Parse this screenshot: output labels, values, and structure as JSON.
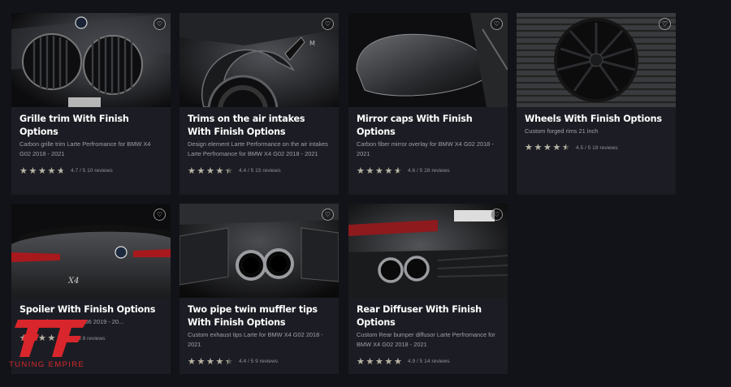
{
  "cards": [
    {
      "title": "Grille trim With Finish Options",
      "description": "Carbon grille trim Larte Perfromance for BMW X4 G02 2018 - 2021",
      "rating": 4.7,
      "rating_text": "4.7 / 5 10 reviews",
      "image_icon": "bmw-grille-photo"
    },
    {
      "title": "Trims on the air intakes With Finish Options",
      "description": "Design element Larte Performance on the air intakes Larte Perfromance for BMW X4 G02 2018 - 2021",
      "rating": 4.4,
      "rating_text": "4.4 / 5 15 reviews",
      "image_icon": "wheel-arch-photo"
    },
    {
      "title": "Mirror caps With Finish Options",
      "description": "Carbon fiber mirror overlay for BMW X4 G02 2018 - 2021",
      "rating": 4.6,
      "rating_text": "4.6 / 5 28 reviews",
      "image_icon": "mirror-cap-photo"
    },
    {
      "title": "Wheels With Finish Options",
      "description": "Custom forged rims 21 inch",
      "rating": 4.5,
      "rating_text": "4.5 / 5 18 reviews",
      "image_icon": "forged-wheel-photo"
    },
    {
      "title": "Spoiler With Finish Options",
      "description": "...rmance for BMW X6 G06 2019 - 20...",
      "rating": 5,
      "rating_text": "5 / 5 8 reviews",
      "image_icon": "spoiler-photo"
    },
    {
      "title": "Two pipe twin muffler tips With Finish Options",
      "description": "Custom exhaust tips Larte for BMW X4 G02 2018 - 2021",
      "rating": 4.4,
      "rating_text": "4.4 / 5 9 reviews",
      "image_icon": "exhaust-tips-photo"
    },
    {
      "title": "Rear Diffuser With Finish Options",
      "description": "Custom Rear bumper diffusor Larte Perfromance for BMW X4 G02 2018 - 2021",
      "rating": 4.9,
      "rating_text": "4.9 / 5 14 reviews",
      "image_icon": "rear-diffuser-photo"
    }
  ],
  "wishlist_icon": "heart-icon",
  "brand": {
    "name": "TUNING EMPIRE",
    "color": "#d8262c"
  },
  "colors": {
    "page_bg": "#121318",
    "card_bg": "#1c1d24",
    "star_filled": "#b7b3a3",
    "star_empty": "#555751"
  }
}
